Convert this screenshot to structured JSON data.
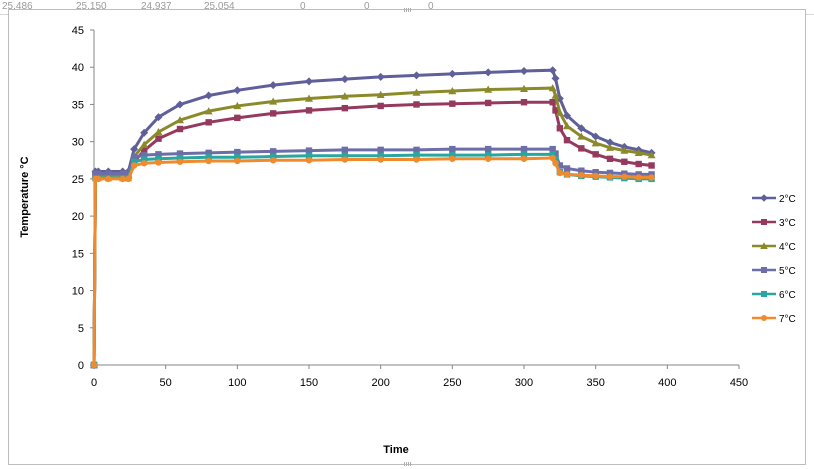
{
  "sheet_row": [
    "25.486",
    "25.150",
    "24.937",
    "25.054",
    "0",
    "0",
    "0"
  ],
  "chart_data": {
    "type": "line",
    "title": "",
    "xlabel": "Time",
    "ylabel": "Temperature °C",
    "xlim": [
      0,
      450
    ],
    "ylim": [
      0,
      45
    ],
    "xticks": [
      0,
      50,
      100,
      150,
      200,
      250,
      300,
      350,
      400,
      450
    ],
    "yticks": [
      0,
      5,
      10,
      15,
      20,
      25,
      30,
      35,
      40,
      45
    ],
    "grid": false,
    "legend_position": "right",
    "x": [
      0,
      1,
      3,
      10,
      20,
      24,
      28,
      35,
      45,
      60,
      80,
      100,
      125,
      150,
      175,
      200,
      225,
      250,
      275,
      300,
      320,
      322,
      325,
      330,
      340,
      350,
      360,
      370,
      380,
      389
    ],
    "series": [
      {
        "name": "2°C",
        "color": "#5f5f9a",
        "marker": "diamond",
        "values": [
          0,
          26,
          26,
          26,
          26,
          26,
          29,
          31.2,
          33.3,
          35,
          36.2,
          36.9,
          37.6,
          38.1,
          38.4,
          38.7,
          38.9,
          39.1,
          39.3,
          39.5,
          39.6,
          38.5,
          35.8,
          33.5,
          31.8,
          30.7,
          29.9,
          29.3,
          28.9,
          28.5
        ]
      },
      {
        "name": "3°C",
        "color": "#953a5e",
        "marker": "square",
        "values": [
          0,
          25.5,
          25.5,
          25.5,
          25.5,
          25.5,
          27.3,
          28.8,
          30.4,
          31.7,
          32.6,
          33.2,
          33.8,
          34.2,
          34.5,
          34.8,
          35.0,
          35.1,
          35.2,
          35.3,
          35.3,
          34.2,
          31.8,
          30.2,
          29.1,
          28.3,
          27.7,
          27.3,
          27.0,
          26.8
        ]
      },
      {
        "name": "4°C",
        "color": "#8a8a2a",
        "marker": "triangle",
        "values": [
          0,
          25.5,
          25.5,
          25.5,
          25.5,
          25.5,
          28,
          29.6,
          31.3,
          32.9,
          34.1,
          34.8,
          35.4,
          35.8,
          36.1,
          36.3,
          36.6,
          36.8,
          37,
          37.1,
          37.2,
          36.2,
          33.9,
          32.1,
          30.7,
          29.8,
          29.2,
          28.8,
          28.5,
          28.2
        ]
      },
      {
        "name": "5°C",
        "color": "#6d6da8",
        "marker": "square",
        "values": [
          0,
          25.7,
          25.7,
          25.7,
          25.7,
          25.7,
          27.9,
          28.2,
          28.3,
          28.4,
          28.5,
          28.6,
          28.7,
          28.8,
          28.9,
          28.9,
          28.9,
          29.0,
          29.0,
          29.0,
          29.0,
          28.4,
          26.8,
          26.4,
          26.1,
          25.9,
          25.8,
          25.7,
          25.6,
          25.6
        ]
      },
      {
        "name": "6°C",
        "color": "#2aa6a0",
        "marker": "square",
        "values": [
          0,
          25.1,
          25.1,
          25.1,
          25.1,
          25.1,
          27.3,
          27.6,
          27.7,
          27.8,
          27.9,
          27.9,
          28.0,
          28.1,
          28.1,
          28.1,
          28.2,
          28.2,
          28.2,
          28.3,
          28.3,
          27.6,
          25.9,
          25.6,
          25.4,
          25.3,
          25.2,
          25.1,
          25.0,
          25.0
        ]
      },
      {
        "name": "7°C",
        "color": "#f08a2c",
        "marker": "circle",
        "values": [
          0,
          25,
          25,
          25,
          25,
          25,
          26.8,
          27.1,
          27.2,
          27.3,
          27.4,
          27.4,
          27.5,
          27.5,
          27.6,
          27.6,
          27.6,
          27.7,
          27.7,
          27.7,
          27.8,
          27.1,
          25.8,
          25.6,
          25.5,
          25.4,
          25.3,
          25.3,
          25.2,
          25.2
        ]
      }
    ]
  }
}
